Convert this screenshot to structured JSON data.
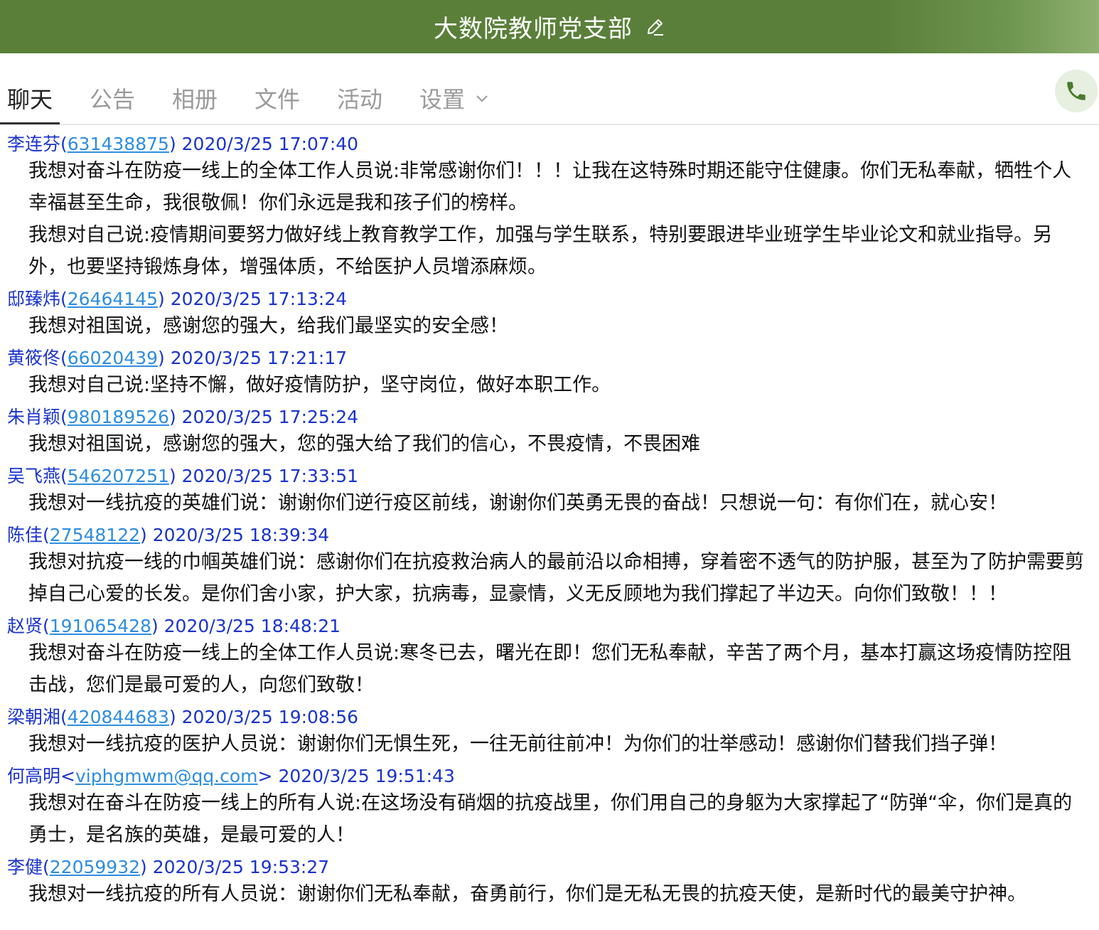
{
  "header": {
    "title": "大数院教师党支部",
    "edit_icon": "pencil-icon"
  },
  "tabs": [
    {
      "label": "聊天",
      "active": true
    },
    {
      "label": "公告"
    },
    {
      "label": "相册"
    },
    {
      "label": "文件"
    },
    {
      "label": "活动"
    },
    {
      "label": "设置"
    }
  ],
  "phone_icon": "phone-icon",
  "messages": [
    {
      "name": "李连芬",
      "id": "631438875",
      "open": "(",
      "close": ")",
      "time": "2020/3/25 17:07:40",
      "paragraphs": [
        "我想对奋斗在防疫一线上的全体工作人员说:非常感谢你们！！！让我在这特殊时期还能守住健康。你们无私奉献，牺牲个人幸福甚至生命，我很敬佩！你们永远是我和孩子们的榜样。",
        "我想对自己说:疫情期间要努力做好线上教育教学工作，加强与学生联系，特别要跟进毕业班学生毕业论文和就业指导。另外，也要坚持锻炼身体，增强体质，不给医护人员增添麻烦。"
      ]
    },
    {
      "name": "邸臻炜",
      "id": "26464145",
      "open": "(",
      "close": ")",
      "time": "2020/3/25 17:13:24",
      "paragraphs": [
        "我想对祖国说，感谢您的强大，给我们最坚实的安全感！"
      ]
    },
    {
      "name": "黄筱佟",
      "id": "66020439",
      "open": "(",
      "close": ")",
      "time": "2020/3/25 17:21:17",
      "paragraphs": [
        "我想对自己说:坚持不懈，做好疫情防护，坚守岗位，做好本职工作。"
      ]
    },
    {
      "name": "朱肖颖",
      "id": "980189526",
      "open": "(",
      "close": ")",
      "time": "2020/3/25 17:25:24",
      "paragraphs": [
        "我想对祖国说，感谢您的强大，您的强大给了我们的信心，不畏疫情，不畏困难"
      ]
    },
    {
      "name": "吴飞燕",
      "id": "546207251",
      "open": "(",
      "close": ")",
      "time": "2020/3/25 17:33:51",
      "paragraphs": [
        "我想对一线抗疫的英雄们说：谢谢你们逆行疫区前线，谢谢你们英勇无畏的奋战！只想说一句：有你们在，就心安！"
      ]
    },
    {
      "name": "陈佳",
      "id": "27548122",
      "open": "(",
      "close": ")",
      "time": "2020/3/25 18:39:34",
      "paragraphs": [
        "我想对抗疫一线的巾帼英雄们说：感谢你们在抗疫救治病人的最前沿以命相搏，穿着密不透气的防护服，甚至为了防护需要剪掉自己心爱的长发。是你们舍小家，护大家，抗病毒，显豪情，义无反顾地为我们撑起了半边天。向你们致敬！！！"
      ]
    },
    {
      "name": "赵贤",
      "id": "191065428",
      "open": "(",
      "close": ")",
      "time": "2020/3/25 18:48:21",
      "paragraphs": [
        "我想对奋斗在防疫一线上的全体工作人员说:寒冬已去，曙光在即！您们无私奉献，辛苦了两个月，基本打赢这场疫情防控阻击战，您们是最可爱的人，向您们致敬！"
      ]
    },
    {
      "name": "梁朝湘",
      "id": "420844683",
      "open": "(",
      "close": ")",
      "time": "2020/3/25 19:08:56",
      "paragraphs": [
        "我想对一线抗疫的医护人员说：谢谢你们无惧生死，一往无前往前冲！为你们的壮举感动！感谢你们替我们挡子弹！"
      ]
    },
    {
      "name": "何高明",
      "id": "viphgmwm@qq.com",
      "open": "<",
      "close": ">",
      "time": "2020/3/25 19:51:43",
      "paragraphs": [
        "我想对在奋斗在防疫一线上的所有人说:在这场没有硝烟的抗疫战里，你们用自己的身躯为大家撑起了“防弹“伞，你们是真的勇士，是名族的英雄，是最可爱的人！"
      ]
    },
    {
      "name": "李健",
      "id": "22059932",
      "open": "(",
      "close": ")",
      "time": "2020/3/25 19:53:27",
      "paragraphs": [
        "我想对一线抗疫的所有人员说：谢谢你们无私奉献，奋勇前行，你们是无私无畏的抗疫天使，是新时代的最美守护神。"
      ]
    }
  ]
}
